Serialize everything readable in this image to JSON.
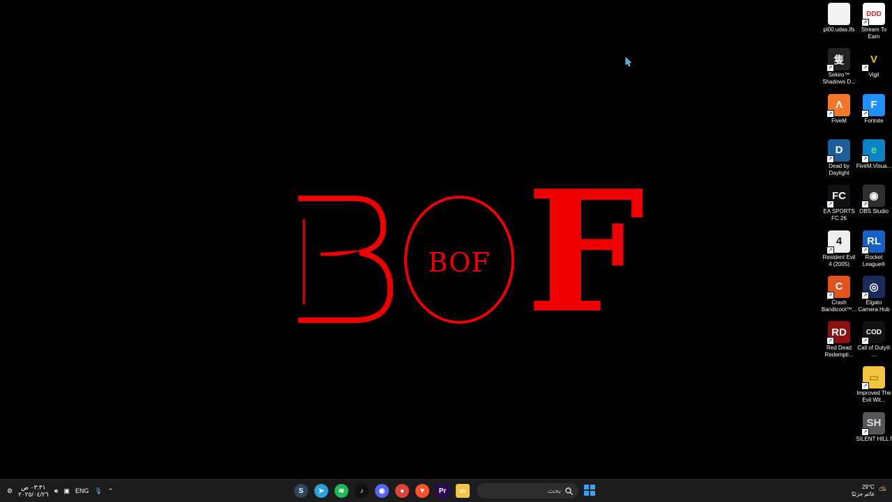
{
  "wallpaper": {
    "logo_b": "B",
    "logo_inner": "BOF",
    "logo_f": "F",
    "color": "#e00000"
  },
  "desktop_icons": {
    "col_right": [
      {
        "label": "Stream To Earn",
        "icon": "ddd-icon"
      },
      {
        "label": "Vigil",
        "icon": "vigil-icon"
      },
      {
        "label": "Fortnite",
        "icon": "fortnite-icon"
      },
      {
        "label": "FiveM.Visua...",
        "icon": "edge-icon"
      },
      {
        "label": "OBS Studio",
        "icon": "obs-icon"
      },
      {
        "label": "Rocket League®",
        "icon": "rocket-league-icon"
      },
      {
        "label": "Elgato Camera Hub",
        "icon": "elgato-icon"
      },
      {
        "label": "Call of Duty® ...",
        "icon": "call-of-duty-icon"
      },
      {
        "label": "Improved The Evil Wit...",
        "icon": "folder-icon"
      },
      {
        "label": "SILENT HILL f",
        "icon": "silent-hill-icon"
      }
    ],
    "col_left": [
      {
        "label": "pl00.udas.lfs",
        "icon": "file-icon"
      },
      {
        "label": "Sekiro™ Shadows D...",
        "icon": "sekiro-icon"
      },
      {
        "label": "FiveM",
        "icon": "fivem-icon"
      },
      {
        "label": "Dead by Daylight",
        "icon": "dead-by-daylight-icon"
      },
      {
        "label": "EA SPORTS FC 26",
        "icon": "ea-fc-icon"
      },
      {
        "label": "Resident Evil 4 (2005)",
        "icon": "resident-evil-icon"
      },
      {
        "label": "Crash Bandicoot™...",
        "icon": "crash-icon"
      },
      {
        "label": "Red Dead Redempti...",
        "icon": "red-dead-icon"
      }
    ]
  },
  "taskbar": {
    "clock_time": "٠٣:٣١ ص",
    "clock_date": "٢٠٢٥/٠٤/٢٦",
    "language": "ENG",
    "search_placeholder": "بحث",
    "weather_temp": "29°C",
    "weather_desc": "غائم جزئيًا",
    "apps": [
      {
        "name": "steam-icon",
        "color": "#2a475e",
        "glyph": "S"
      },
      {
        "name": "telegram-icon",
        "color": "#2aa1da",
        "glyph": "➤"
      },
      {
        "name": "spotify-icon",
        "color": "#1db954",
        "glyph": "≋"
      },
      {
        "name": "tiktok-icon",
        "color": "#111111",
        "glyph": "♪"
      },
      {
        "name": "discord-icon",
        "color": "#5865f2",
        "glyph": "◉"
      },
      {
        "name": "chrome-icon",
        "color": "#db4437",
        "glyph": "●"
      },
      {
        "name": "brave-icon",
        "color": "#fb542b",
        "glyph": "▼"
      },
      {
        "name": "premiere-icon",
        "color": "#2a0a50",
        "glyph": "Pr"
      },
      {
        "name": "file-explorer-icon",
        "color": "#f4c542",
        "glyph": "▭"
      }
    ]
  }
}
